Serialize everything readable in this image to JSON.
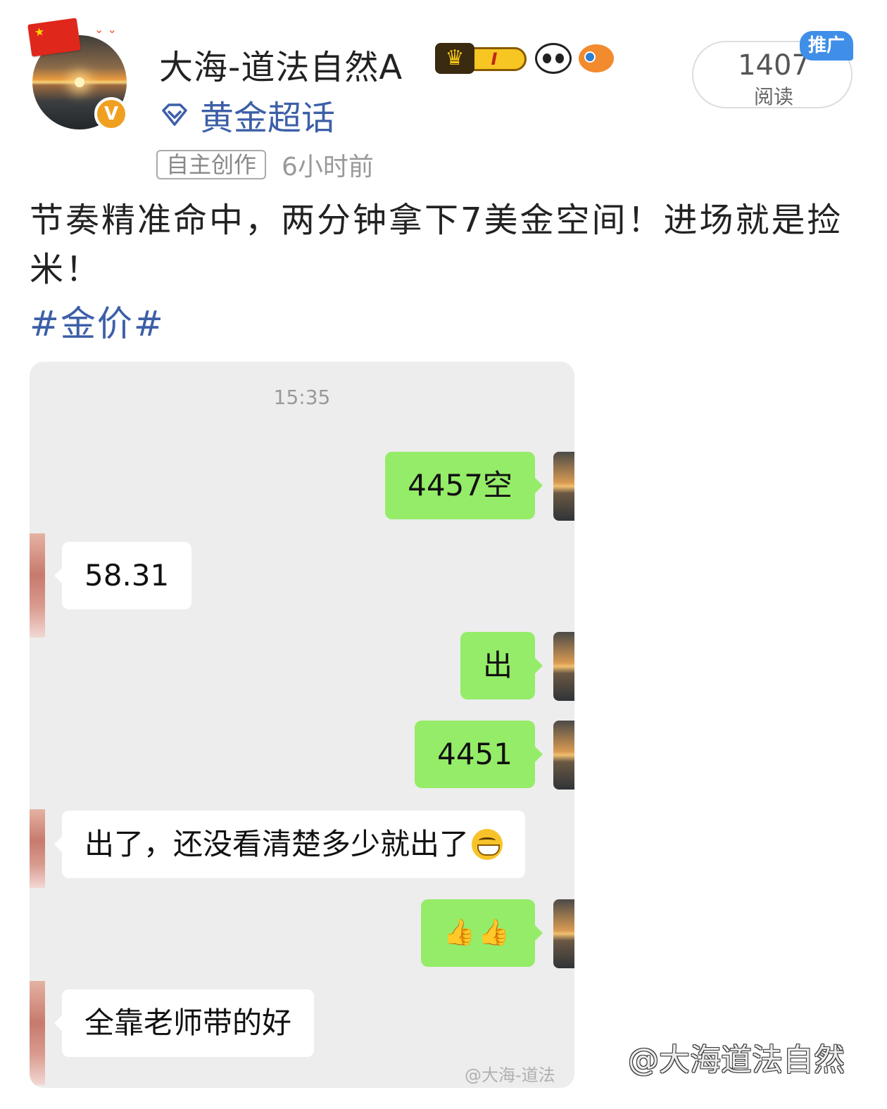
{
  "author": {
    "name": "大海-道法自然A",
    "verified_icon": "V",
    "level_badge": "I",
    "topic_label": "黄金超话"
  },
  "meta": {
    "tag": "自主创作",
    "time": "6小时前"
  },
  "reads": {
    "count": "1407",
    "label": "阅读",
    "promo": "推广"
  },
  "post": {
    "text": "节奏精准命中，两分钟拿下7美金空间！进场就是捡米！",
    "hashtag": "#金价#"
  },
  "chat": {
    "timestamp": "15:35",
    "messages": [
      {
        "side": "out",
        "text": "4457空"
      },
      {
        "side": "in",
        "text": "58.31"
      },
      {
        "side": "out",
        "text": "出"
      },
      {
        "side": "out",
        "text": "4451"
      },
      {
        "side": "in",
        "text": "出了，还没看清楚多少就出了"
      },
      {
        "side": "out",
        "text": "👍👍"
      },
      {
        "side": "in",
        "text": "全靠老师带的好"
      }
    ]
  },
  "watermarks": {
    "small": "@大海-道法",
    "large": "@大海道法自然"
  },
  "colors": {
    "link_blue": "#3d5fa8",
    "bubble_green": "#95ec69",
    "chat_bg": "#ededed",
    "verified_orange": "#f0a020",
    "promo_blue": "#3f8ee8"
  }
}
